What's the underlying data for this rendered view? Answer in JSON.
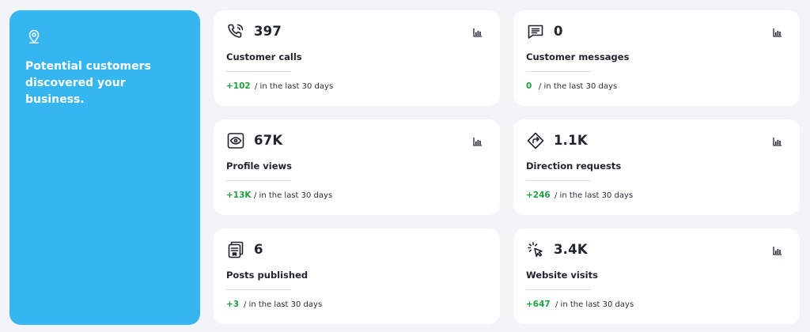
{
  "hero": {
    "headline": "Potential customers discovered your business.",
    "icon": "location-pin-icon",
    "background": "#36b6f0"
  },
  "colors": {
    "positive": "#1e9e3e",
    "card_bg": "#ffffff",
    "page_bg": "#f3f4f8"
  },
  "cards": [
    {
      "id": "customer-calls",
      "icon": "phone-icon",
      "value": "397",
      "label": "Customer calls",
      "change": "+102",
      "period": "/ in the last 30 days"
    },
    {
      "id": "customer-messages",
      "icon": "message-icon",
      "value": "0",
      "label": "Customer messages",
      "change": "0",
      "period": "/ in the last 30 days"
    },
    {
      "id": "profile-views",
      "icon": "eye-icon",
      "value": "67K",
      "label": "Profile views",
      "change": "+13K",
      "period": "/ in the last 30 days"
    },
    {
      "id": "direction-requests",
      "icon": "directions-icon",
      "value": "1.1K",
      "label": "Direction requests",
      "change": "+246",
      "period": "/ in the last 30 days"
    },
    {
      "id": "posts-published",
      "icon": "posts-icon",
      "value": "6",
      "label": "Posts published",
      "change": "+3",
      "period": "/ in the last 30 days"
    },
    {
      "id": "website-visits",
      "icon": "cursor-click-icon",
      "value": "3.4K",
      "label": "Website visits",
      "change": "+647",
      "period": "/ in the last 30 days"
    }
  ]
}
